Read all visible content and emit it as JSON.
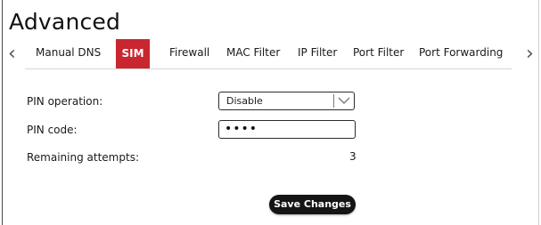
{
  "page": {
    "title": "Advanced"
  },
  "tabs": {
    "prev_icon": "chevron-left-icon",
    "next_icon": "chevron-right-icon",
    "items": [
      {
        "label": "Manual DNS",
        "active": false
      },
      {
        "label": "SIM",
        "active": true
      },
      {
        "label": "Firewall",
        "active": false
      },
      {
        "label": "MAC Filter",
        "active": false
      },
      {
        "label": "IP Filter",
        "active": false
      },
      {
        "label": "Port Filter",
        "active": false
      },
      {
        "label": "Port Forwarding",
        "active": false
      }
    ],
    "active_color": "#c9262f"
  },
  "form": {
    "pin_operation": {
      "label": "PIN operation:",
      "value": "Disable",
      "icon": "chevron-down-icon"
    },
    "pin_code": {
      "label": "PIN code:",
      "value": "••••"
    },
    "remaining_attempts": {
      "label": "Remaining attempts:",
      "value": "3"
    }
  },
  "actions": {
    "save_label": "Save Changes"
  }
}
